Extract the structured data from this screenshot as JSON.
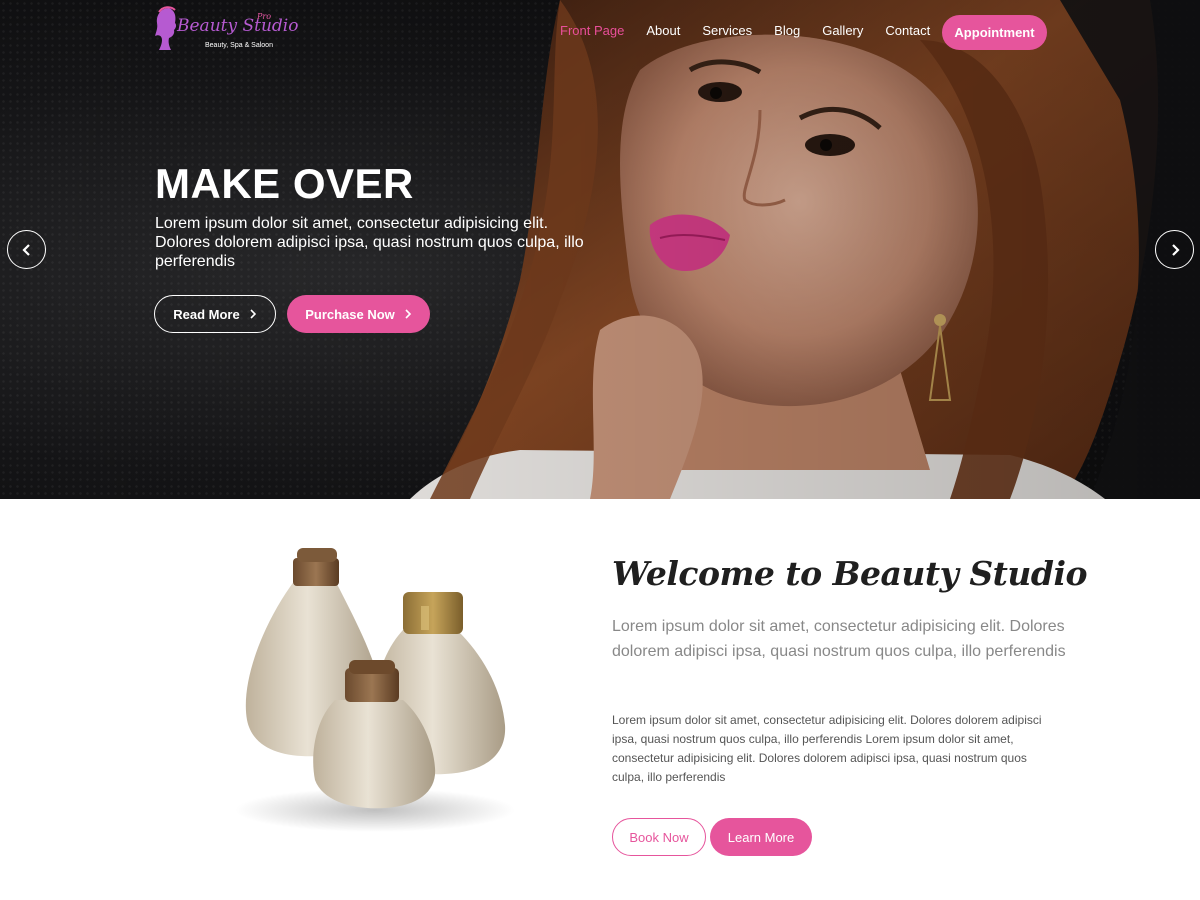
{
  "brand": {
    "name": "Beauty Studio",
    "badge": "Pro",
    "tagline": "Beauty, Spa & Saloon"
  },
  "nav": {
    "items": [
      {
        "label": "Front Page",
        "active": true
      },
      {
        "label": "About"
      },
      {
        "label": "Services"
      },
      {
        "label": "Blog"
      },
      {
        "label": "Gallery"
      },
      {
        "label": "Contact"
      }
    ],
    "cta_label": "Appointment"
  },
  "hero": {
    "title": "MAKE OVER",
    "text": "Lorem ipsum dolor sit amet, consectetur adipisicing elit. Dolores dolorem adipisci ipsa, quasi nostrum quos culpa, illo perferendis",
    "primary_label": "Read More",
    "secondary_label": "Purchase Now"
  },
  "welcome": {
    "title": "Welcome to Beauty Studio",
    "lead": "Lorem ipsum dolor sit amet, consectetur adipisicing elit. Dolores dolorem adipisci ipsa, quasi nostrum quos culpa, illo perferendis",
    "body": "Lorem ipsum dolor sit amet, consectetur adipisicing elit. Dolores dolorem adipisci ipsa, quasi nostrum quos culpa, illo perferendis Lorem ipsum dolor sit amet, consectetur adipisicing elit. Dolores dolorem adipisci ipsa, quasi nostrum quos culpa, illo perferendis",
    "book_label": "Book Now",
    "learn_label": "Learn More"
  },
  "colors": {
    "accent": "#e6559c",
    "hero_bg": "#141416",
    "logo": "#b65ad1"
  },
  "icons": {
    "slider_prev": "chevron-left-icon",
    "slider_next": "chevron-right-icon",
    "button_arrow": "chevron-right-icon"
  }
}
